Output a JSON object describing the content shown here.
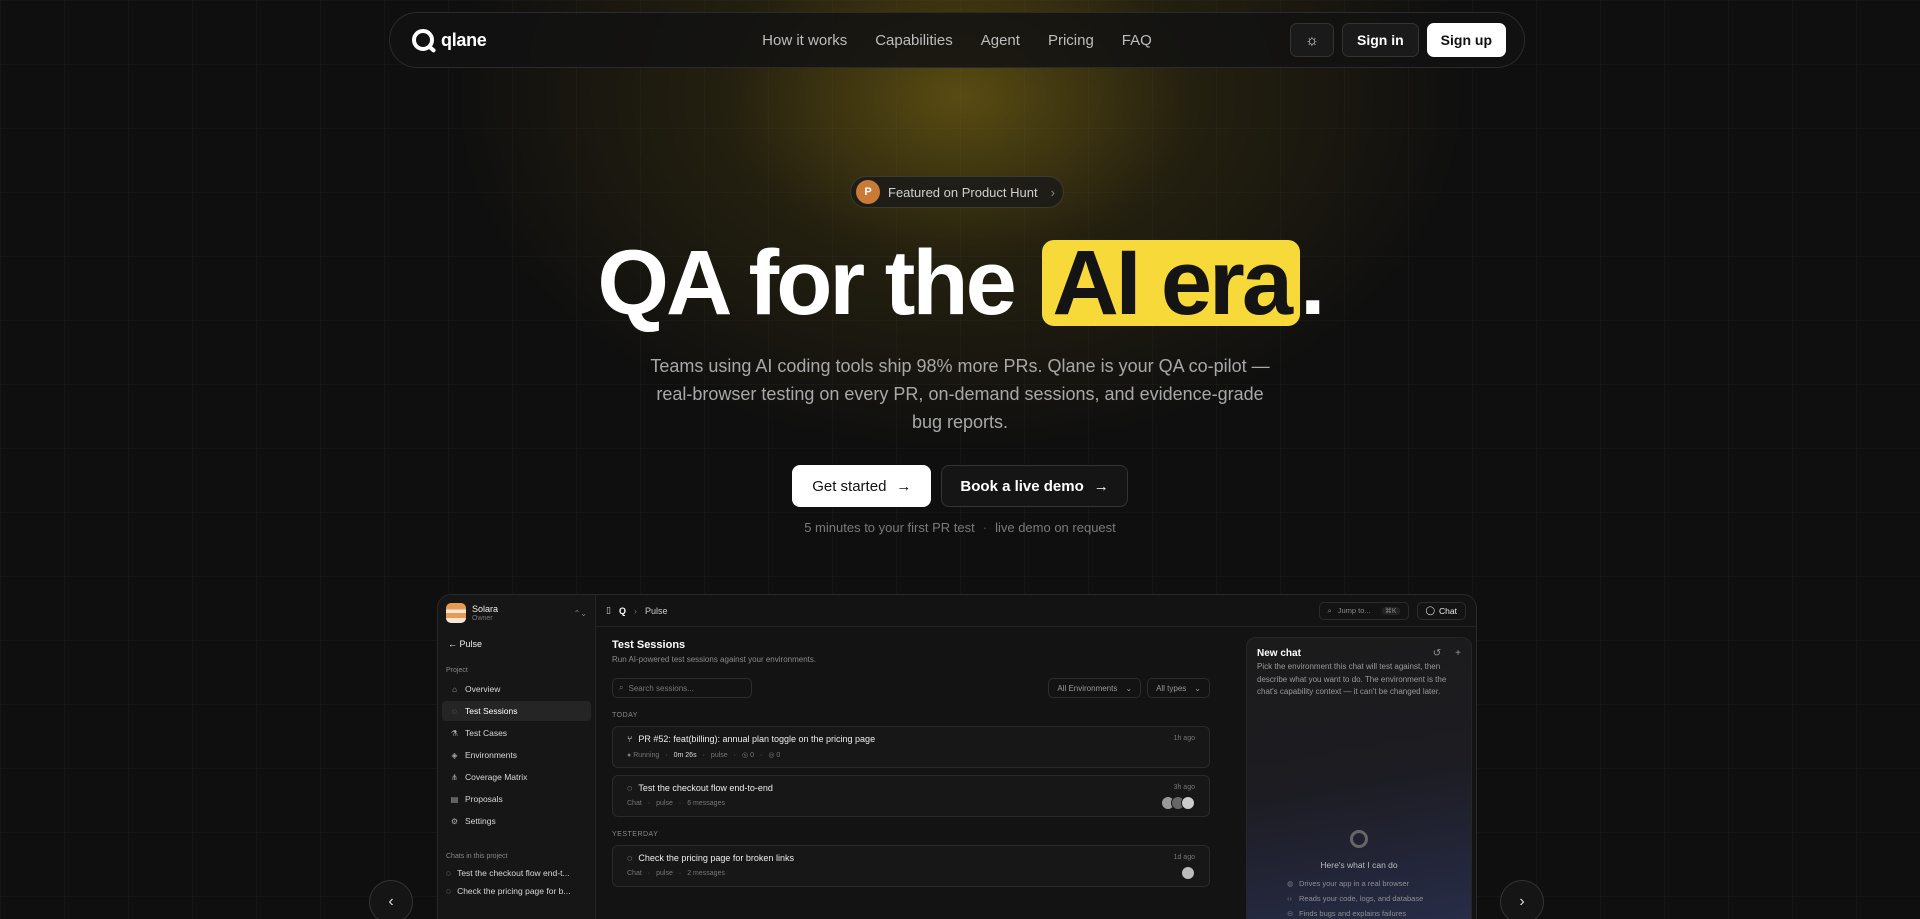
{
  "nav": {
    "brand": "qlane",
    "links": [
      "How it works",
      "Capabilities",
      "Agent",
      "Pricing",
      "FAQ"
    ],
    "theme_icon": "sun-icon",
    "signin": "Sign in",
    "signup": "Sign up"
  },
  "hero": {
    "badge_letter": "P",
    "badge_text": "Featured on Product Hunt",
    "headline_start": "QA for the",
    "headline_highlight": "AI era",
    "headline_end": ".",
    "subhead": "Teams using AI coding tools ship 98% more PRs. Qlane is your QA co-pilot — real-browser testing on every PR, on-demand sessions, and evidence-grade bug reports.",
    "cta_primary": "Get started",
    "cta_secondary": "Book a live demo",
    "note_left": "5 minutes to your first PR test",
    "note_right": "live demo on request",
    "accent": "#f8d93a"
  },
  "app": {
    "org_name": "Solara",
    "org_role": "Owner",
    "back_label": "Pulse",
    "section_label": "Project",
    "nav_items": [
      {
        "label": "Overview",
        "icon": "home-icon"
      },
      {
        "label": "Test Sessions",
        "icon": "chat-icon"
      },
      {
        "label": "Test Cases",
        "icon": "flask-icon"
      },
      {
        "label": "Environments",
        "icon": "cube-icon"
      },
      {
        "label": "Coverage Matrix",
        "icon": "share-icon"
      },
      {
        "label": "Proposals",
        "icon": "doc-icon"
      },
      {
        "label": "Settings",
        "icon": "gear-icon"
      }
    ],
    "chats_label": "Chats in this project",
    "chats": [
      "Test the checkout flow end-t...",
      "Check the pricing page for b..."
    ],
    "breadcrumb": "Pulse",
    "jump_placeholder": "Jump to...",
    "jump_kbd": "⌘K",
    "chat_button": "Chat",
    "sessions_title": "Test Sessions",
    "sessions_sub": "Run AI-powered test sessions against your environments.",
    "search_placeholder": "Search sessions...",
    "filter_env": "All Environments",
    "filter_type": "All types",
    "today_label": "TODAY",
    "yesterday_label": "YESTERDAY",
    "cards": [
      {
        "title": "PR #52: feat(billing): annual plan toggle on the pricing page",
        "time": "1h ago",
        "status": "Running",
        "duration": "0m 26s",
        "env": "pulse",
        "count_a": "0",
        "count_b": "0"
      },
      {
        "title": "Test the checkout flow end-to-end",
        "time": "3h ago",
        "kind": "Chat",
        "env": "pulse",
        "messages": "6 messages"
      },
      {
        "title": "Check the pricing page for broken links",
        "time": "1d ago",
        "kind": "Chat",
        "env": "pulse",
        "messages": "2 messages"
      }
    ],
    "chat_panel": {
      "title": "New chat",
      "desc": "Pick the environment this chat will test against, then describe what you want to do. The environment is the chat's capability context — it can't be changed later.",
      "can_title": "Here's what I can do",
      "capabilities": [
        "Drives your app in a real browser",
        "Reads your code, logs, and database",
        "Finds bugs and explains failures"
      ]
    }
  }
}
